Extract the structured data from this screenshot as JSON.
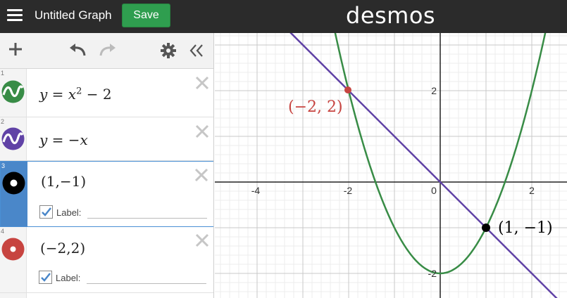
{
  "header": {
    "title": "Untitled Graph",
    "save_label": "Save",
    "logo": "desmos"
  },
  "toolbar": {
    "icons": [
      "plus-icon",
      "undo-icon",
      "redo-icon",
      "gear-icon",
      "collapse-panel-icon"
    ]
  },
  "expressions": [
    {
      "index": "1",
      "color": "#388c46",
      "icon": "parabola-curve-icon"
    },
    {
      "index": "2",
      "color": "#6042a6",
      "icon": "curve-icon"
    },
    {
      "index": "3",
      "color": "#000000",
      "icon": "point-icon",
      "label_checked": true,
      "label_text": "Label:"
    },
    {
      "index": "4",
      "color": "#c74440",
      "icon": "point-icon",
      "label_checked": true,
      "label_text": "Label:"
    }
  ],
  "graph": {
    "x_ticks": [
      "-4",
      "-2",
      "0",
      "2"
    ],
    "y_ticks": [
      "2",
      "-2"
    ],
    "point_labels": [
      "(−2, 2)",
      "(1, −1)"
    ]
  },
  "colors": {
    "topbar": "#2b2b2b",
    "save": "#2f9e4f",
    "green": "#388c46",
    "purple": "#6042a6",
    "red": "#c74440",
    "black": "#000000"
  }
}
